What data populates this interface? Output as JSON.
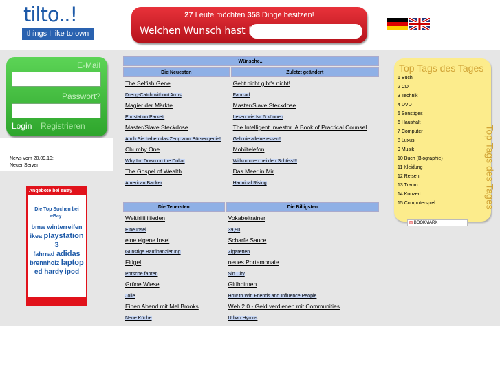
{
  "logo": {
    "title": "tilto..!",
    "tagline": "things I like to own"
  },
  "banner": {
    "count_people": "27",
    "text_mid": "Leute möchten",
    "count_things": "358",
    "text_end": "Dinge besitzen!",
    "question": "Welchen Wunsch hast Du?",
    "input_value": ""
  },
  "login": {
    "email_label": "E-Mail",
    "password_label": "Passwort?",
    "login": "Login",
    "register": "Registrieren"
  },
  "news": {
    "item": "News vom 20.09.10:",
    "sub": "Neuer Server"
  },
  "ebay": {
    "title": "Angebote bei eBay",
    "heading": "Die Top Suchen bei eBay:",
    "links": [
      "bmw",
      "winterreifen",
      "ikea",
      "playstation 3",
      "fahrrad",
      "adidas",
      "brennholz",
      "laptop",
      "ed hardy",
      "ipod"
    ]
  },
  "wishes": {
    "title": "Wünsche...",
    "col1": "Die Neuesten",
    "col2": "Zuletzt geändert",
    "rows": [
      [
        "The Selfish Gene",
        "Geht nicht gibt's nicht!"
      ],
      [
        "Dredg-Catch without Arms",
        "Fahrrad"
      ],
      [
        "Magier der Märkte",
        "Master/Slave Steckdose"
      ],
      [
        "Endstation Parkett",
        "Lesen wie Nr. 5 können"
      ],
      [
        "Master/Slave Steckdose",
        "The Intelligent Investor. A Book of Practical Counsel"
      ],
      [
        "Auch Sie haben das Zeug zum Börsengenie!",
        "Geh nie alleine essen!"
      ],
      [
        "Chumby One",
        "Mobiltelefon"
      ],
      [
        "Why I'm Down on the Dollar",
        "Willkommen bei den Schtiss!!!"
      ],
      [
        "The Gospel of Wealth",
        "Das Meer in Mir"
      ],
      [
        "American Banker",
        "Hannibal Rising"
      ]
    ],
    "col3": "Die Teuersten",
    "col4": "Die Billigsten",
    "rows2": [
      [
        "Weltfriiiiiiiiieden",
        "Vokabeltrainer"
      ],
      [
        "Eine Insel",
        "39,90"
      ],
      [
        "eine eigene Insel",
        "Scharfe Sauce"
      ],
      [
        "Günstige Baufinanzierung",
        "Zigaretten"
      ],
      [
        "Flügel",
        "neues Portemonaie"
      ],
      [
        "Porsche fahren",
        "Sin City"
      ],
      [
        "Grüne Wiese",
        "Glühbirnen"
      ],
      [
        "Jolie",
        "How to Win Friends and Influence People"
      ],
      [
        "Einen Abend mit Mel Brooks",
        "Web 2.0 - Geld verdienen mit Communities"
      ],
      [
        "Neue Küche",
        "Urban Hymns"
      ]
    ]
  },
  "tags": {
    "title": "Top Tags des Tages",
    "items": [
      "Buch",
      "CD",
      "Technik",
      "DVD",
      "Sonstiges",
      "Haushalt",
      "Computer",
      "Luxus",
      "Musik",
      "Buch (Biographie)",
      "Kleidung",
      "Reisen",
      "Traum",
      "Konzert",
      "Computerspiel"
    ]
  },
  "bookmark": "BOOKMARK"
}
